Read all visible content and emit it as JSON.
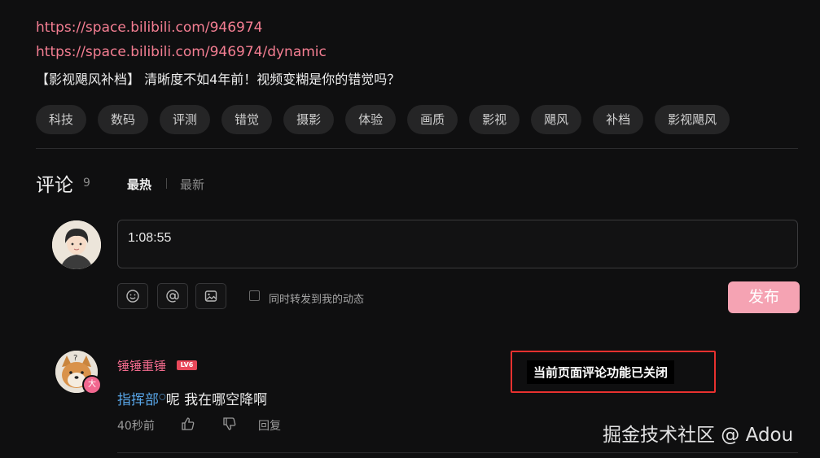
{
  "links": {
    "space_url": "https://space.bilibili.com/946974",
    "dynamic_url": "https://space.bilibili.com/946974/dynamic"
  },
  "video": {
    "title": "【影视飓风补档】 清晰度不如4年前！视频变糊是你的错觉吗？"
  },
  "tags": [
    "科技",
    "数码",
    "评测",
    "错觉",
    "摄影",
    "体验",
    "画质",
    "影视",
    "飓风",
    "补档",
    "影视飓风"
  ],
  "comments_section": {
    "title": "评论",
    "count": "9",
    "sort_hot": "最热",
    "sort_new": "最新"
  },
  "composer": {
    "input_value": "1:08:55",
    "forward_label": "同时转发到我的动态",
    "publish_label": "发布",
    "tools": [
      "emoji-icon",
      "at-icon",
      "image-icon"
    ]
  },
  "comment": {
    "username": "锤锤重锤",
    "level": "LV6",
    "avatar_badge": "大",
    "mention": "指挥部",
    "text": "呢 我在哪空降啊",
    "time": "40秒前",
    "reply_label": "回复"
  },
  "annotation": {
    "closed_notice": "当前页面评论功能已关闭",
    "highlight_color": "#e8312f"
  },
  "watermark": "掘金技术社区 @ Adou",
  "colors": {
    "background": "#0f0f10",
    "link": "#f47e92",
    "username": "#f06a8c",
    "mention": "#58a6e8",
    "publish_button": "#f5a3b3"
  }
}
